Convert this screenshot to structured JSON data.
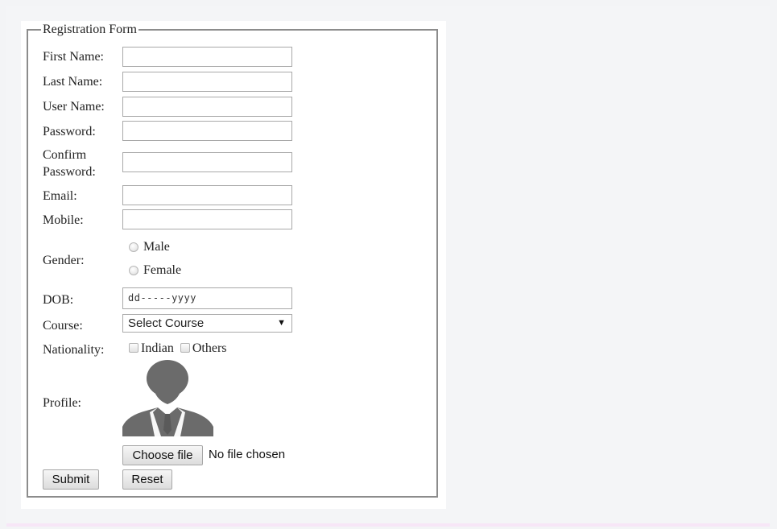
{
  "form": {
    "legend": "Registration Form",
    "fields": {
      "first_name": "First Name:",
      "last_name": "Last Name:",
      "user_name": "User Name:",
      "password": "Password:",
      "confirm_password_1": "Confirm",
      "confirm_password_2": "Password:",
      "email": "Email:",
      "mobile": "Mobile:",
      "gender": "Gender:",
      "dob": "DOB:",
      "course": "Course:",
      "nationality": "Nationality:",
      "profile": "Profile:"
    },
    "values": {
      "first_name": "",
      "last_name": "",
      "user_name": "",
      "password": "",
      "confirm_password": "",
      "email": "",
      "mobile": ""
    },
    "gender_options": [
      "Male",
      "Female"
    ],
    "dob_placeholder": "dd-----yyyy",
    "course_selected": "Select Course",
    "nationality_options": [
      "Indian",
      "Others"
    ],
    "choose_file_label": "Choose file",
    "file_status": "No file chosen",
    "submit_label": "Submit",
    "reset_label": "Reset",
    "avatar_icon": "user-silhouette-icon",
    "dropdown_icon": "▼"
  }
}
